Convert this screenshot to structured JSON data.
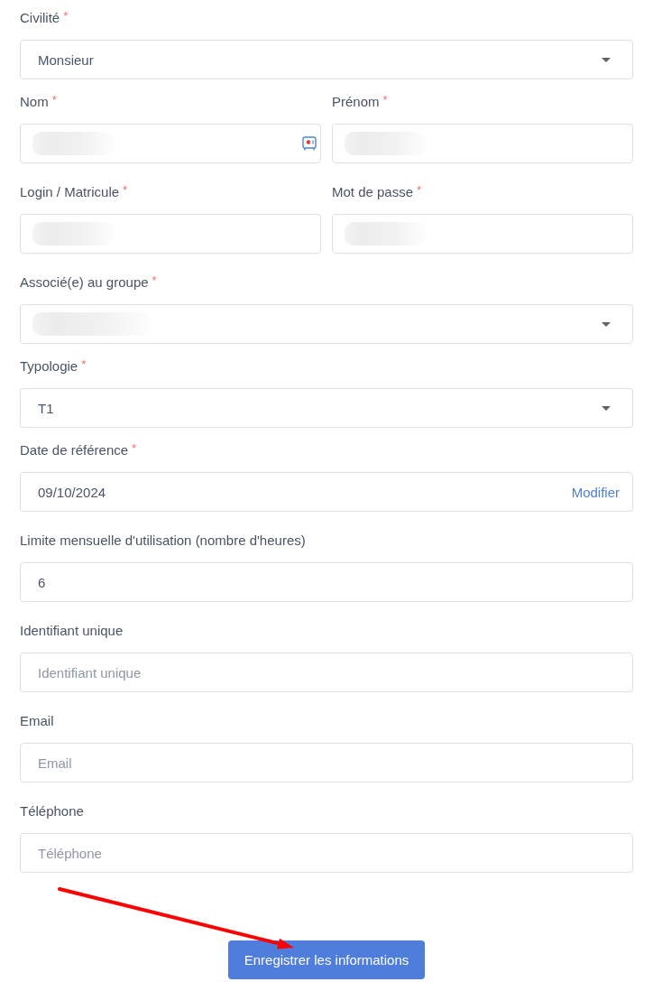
{
  "rows": [
    {
      "fields": [
        {
          "kind": "select",
          "label": "Civilité",
          "required_mark": "*",
          "value": "Monsieur"
        }
      ]
    },
    {
      "fields": [
        {
          "kind": "input",
          "label": "Nom",
          "required_mark": "*",
          "blurred": true,
          "autofill_icon": true
        },
        {
          "kind": "input",
          "label": "Prénom",
          "required_mark": "*",
          "blurred": true
        }
      ]
    },
    {
      "fields": [
        {
          "kind": "input",
          "label": "Login / Matricule",
          "required_mark": "*",
          "blurred": true
        },
        {
          "kind": "input",
          "label": "Mot de passe",
          "required_mark": "*",
          "blurred": true
        }
      ]
    },
    {
      "fields": [
        {
          "kind": "select",
          "label": "Associé(e) au groupe",
          "required_mark": "*",
          "blurred": true
        }
      ]
    },
    {
      "fields": [
        {
          "kind": "select",
          "label": "Typologie",
          "required_mark": "*",
          "value": "T1"
        }
      ]
    },
    {
      "fields": [
        {
          "kind": "date",
          "label": "Date de référence",
          "required_mark": "*",
          "value": "09/10/2024",
          "action": "Modifier"
        }
      ]
    },
    {
      "fields": [
        {
          "kind": "input",
          "label": "Limite mensuelle d'utilisation (nombre d'heures)",
          "value": "6"
        }
      ]
    },
    {
      "fields": [
        {
          "kind": "input",
          "label": "Identifiant unique",
          "placeholder": "Identifiant unique"
        }
      ]
    },
    {
      "fields": [
        {
          "kind": "input",
          "label": "Email",
          "placeholder": "Email"
        }
      ]
    },
    {
      "fields": [
        {
          "kind": "input",
          "label": "Téléphone",
          "placeholder": "Téléphone"
        }
      ]
    }
  ],
  "submit_button": {
    "label": "Enregistrer les informations"
  }
}
